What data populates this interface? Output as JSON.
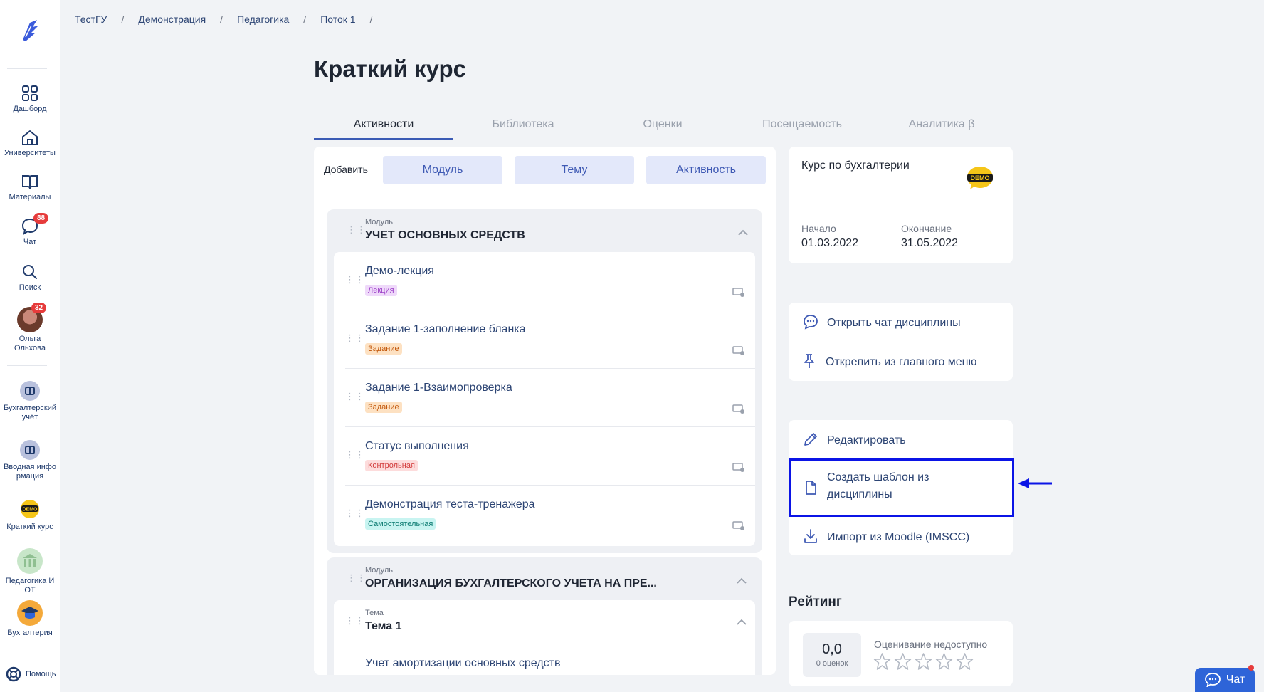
{
  "sidebar": {
    "items": [
      {
        "label": "Дашборд"
      },
      {
        "label": "Университеты"
      },
      {
        "label": "Материалы"
      },
      {
        "label": "Чат",
        "badge": "88"
      },
      {
        "label": "Поиск"
      },
      {
        "label": "Ольга Ольхова",
        "badge": "32"
      },
      {
        "label": "Бухгалтерский учёт"
      },
      {
        "label": "Вводная информация"
      },
      {
        "label": "Краткий курс"
      },
      {
        "label": "Педагогика И ОТ"
      },
      {
        "label": "Бухгалтерия"
      }
    ],
    "help": "Помощь"
  },
  "breadcrumb": [
    "ТестГУ",
    "Демонстрация",
    "Педагогика",
    "Поток 1"
  ],
  "page_title": "Краткий курс",
  "tabs": [
    "Активности",
    "Библиотека",
    "Оценки",
    "Посещаемость",
    "Аналитика β"
  ],
  "add": {
    "label": "Добавить",
    "buttons": [
      "Модуль",
      "Тему",
      "Активность"
    ]
  },
  "modules": [
    {
      "small": "Модуль",
      "name": "УЧЕТ ОСНОВНЫХ СРЕДСТВ",
      "activities": [
        {
          "name": "Демо-лекция",
          "tag": "Лекция"
        },
        {
          "name": "Задание 1-заполнение бланка",
          "tag": "Задание"
        },
        {
          "name": "Задание 1-Взаимопроверка",
          "tag": "Задание"
        },
        {
          "name": "Статус выполнения",
          "tag": "Контрольная"
        },
        {
          "name": "Демонстрация теста-тренажера",
          "tag": "Самостоятельная"
        }
      ]
    },
    {
      "small": "Модуль",
      "name": "ОРГАНИЗАЦИЯ БУХГАЛТЕРСКОГО УЧЕТА НА ПРЕ...",
      "topic": {
        "small": "Тема",
        "name": "Тема 1",
        "first_item": "Учет амортизации основных средств"
      }
    }
  ],
  "course_card": {
    "title": "Курс по бухгалтерии",
    "logo_text": "DEMO",
    "start_label": "Начало",
    "start": "01.03.2022",
    "end_label": "Окончание",
    "end": "31.05.2022"
  },
  "actions1": [
    "Открыть чат дисциплины",
    "Открепить из главного меню"
  ],
  "actions2": {
    "edit": "Редактировать",
    "template_line1": "Создать шаблон из",
    "template_line2": "дисциплины",
    "import": "Импорт из Moodle (IMSCC)"
  },
  "rating": {
    "title": "Рейтинг",
    "value": "0,0",
    "count": "0 оценок",
    "status": "Оценивание недоступно",
    "stars": 0
  },
  "chat_button": "Чат",
  "colors": {
    "accent": "#3f5ab4",
    "highlight": "#0b14e6",
    "badge": "#e63b3b"
  }
}
